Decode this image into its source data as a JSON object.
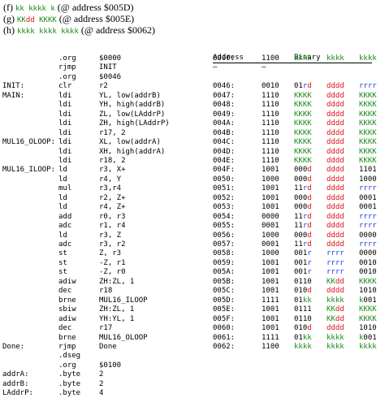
{
  "header_lines": [
    {
      "label": "(f)",
      "parts": [
        {
          "t": "kk",
          "c": "g"
        },
        {
          "t": " ",
          "c": "k"
        },
        {
          "t": "kkkk",
          "c": "g"
        },
        {
          "t": " ",
          "c": "k"
        },
        {
          "t": "k",
          "c": "g"
        }
      ],
      "suffix": "(@ address $005D)"
    },
    {
      "label": "(g)",
      "parts": [
        {
          "t": "KK",
          "c": "g"
        },
        {
          "t": "dd",
          "c": "r"
        },
        {
          "t": " ",
          "c": "k"
        },
        {
          "t": "KKKK",
          "c": "g"
        }
      ],
      "suffix": "(@ address $005E)"
    },
    {
      "label": "(h)",
      "parts": [
        {
          "t": "kkkk",
          "c": "g"
        },
        {
          "t": " ",
          "c": "k"
        },
        {
          "t": "kkkk",
          "c": "g"
        },
        {
          "t": " ",
          "c": "k"
        },
        {
          "t": "kkkk",
          "c": "g"
        }
      ],
      "suffix": "(@ address $0062)"
    }
  ],
  "table_headers": {
    "address": "Address",
    "binary": "Binary"
  },
  "colors": {
    "green": "#1a8a1a",
    "red": "#e0101a",
    "blue": "#1c3cdc"
  },
  "rows": [
    {
      "label": "",
      "op": ".org",
      "arg": "$0000",
      "addr": "0000:",
      "bin": [
        {
          "t": "1100",
          "c": "k"
        },
        {
          "t": "kkkk",
          "c": "g"
        },
        {
          "t": "kkkk",
          "c": "g"
        },
        {
          "t": "kkkk",
          "c": "g"
        }
      ]
    },
    {
      "label": "",
      "op": "rjmp",
      "arg": "INIT",
      "addr": "—",
      "bin": [
        {
          "t": "—",
          "c": "k"
        }
      ]
    },
    {
      "label": "",
      "op": ".org",
      "arg": "$0046",
      "addr": "",
      "bin": []
    },
    {
      "label": "INIT:",
      "op": "clr",
      "arg": "r2",
      "addr": "0046:",
      "bin": [
        {
          "t": "0010",
          "c": "k"
        },
        {
          "t": "01",
          "c": "k"
        },
        {
          "t": "r",
          "c": "b"
        },
        {
          "t": "d",
          "c": "r"
        },
        {
          "t": "dddd",
          "c": "r"
        },
        {
          "t": "rrrr",
          "c": "b"
        }
      ]
    },
    {
      "label": "MAIN:",
      "op": "ldi",
      "arg": "YL, low(addrB)",
      "addr": "0047:",
      "bin": [
        {
          "t": "1110",
          "c": "k"
        },
        {
          "t": "KKKK",
          "c": "g"
        },
        {
          "t": "dddd",
          "c": "r"
        },
        {
          "t": "KKKK",
          "c": "g"
        }
      ]
    },
    {
      "label": "",
      "op": "ldi",
      "arg": "YH, high(addrB)",
      "addr": "0048:",
      "bin": [
        {
          "t": "1110",
          "c": "k"
        },
        {
          "t": "KKKK",
          "c": "g"
        },
        {
          "t": "dddd",
          "c": "r"
        },
        {
          "t": "KKKK",
          "c": "g"
        }
      ]
    },
    {
      "label": "",
      "op": "ldi",
      "arg": "ZL, low(LAddrP)",
      "addr": "0049:",
      "bin": [
        {
          "t": "1110",
          "c": "k"
        },
        {
          "t": "KKKK",
          "c": "g"
        },
        {
          "t": "dddd",
          "c": "r"
        },
        {
          "t": "KKKK",
          "c": "g"
        }
      ]
    },
    {
      "label": "",
      "op": "ldi",
      "arg": "ZH, high(LAddrP)",
      "addr": "004A:",
      "bin": [
        {
          "t": "1110",
          "c": "k"
        },
        {
          "t": "KKKK",
          "c": "g"
        },
        {
          "t": "dddd",
          "c": "r"
        },
        {
          "t": "KKKK",
          "c": "g"
        }
      ]
    },
    {
      "label": "",
      "op": "ldi",
      "arg": "r17, 2",
      "addr": "004B:",
      "bin": [
        {
          "t": "1110",
          "c": "k"
        },
        {
          "t": "KKKK",
          "c": "g"
        },
        {
          "t": "dddd",
          "c": "r"
        },
        {
          "t": "KKKK",
          "c": "g"
        }
      ]
    },
    {
      "label": "MUL16_OLOOP:",
      "op": "ldi",
      "arg": "XL, low(addrA)",
      "addr": "004C:",
      "bin": [
        {
          "t": "1110",
          "c": "k"
        },
        {
          "t": "KKKK",
          "c": "g"
        },
        {
          "t": "dddd",
          "c": "r"
        },
        {
          "t": "KKKK",
          "c": "g"
        }
      ]
    },
    {
      "label": "",
      "op": "ldi",
      "arg": "XH, high(addrA)",
      "addr": "004D:",
      "bin": [
        {
          "t": "1110",
          "c": "k"
        },
        {
          "t": "KKKK",
          "c": "g"
        },
        {
          "t": "dddd",
          "c": "r"
        },
        {
          "t": "KKKK",
          "c": "g"
        }
      ]
    },
    {
      "label": "",
      "op": "ldi",
      "arg": "r18, 2",
      "addr": "004E:",
      "bin": [
        {
          "t": "1110",
          "c": "k"
        },
        {
          "t": "KKKK",
          "c": "g"
        },
        {
          "t": "dddd",
          "c": "r"
        },
        {
          "t": "KKKK",
          "c": "g"
        }
      ]
    },
    {
      "label": "MUL16_ILOOP:",
      "op": "ld",
      "arg": "r3, X+",
      "addr": "004F:",
      "bin": [
        {
          "t": "1001",
          "c": "k"
        },
        {
          "t": "000",
          "c": "k"
        },
        {
          "t": "d",
          "c": "r"
        },
        {
          "t": "dddd",
          "c": "r"
        },
        {
          "t": "1101",
          "c": "k"
        }
      ]
    },
    {
      "label": "",
      "op": "ld",
      "arg": "r4, Y",
      "addr": "0050:",
      "bin": [
        {
          "t": "1000",
          "c": "k"
        },
        {
          "t": "000",
          "c": "k"
        },
        {
          "t": "d",
          "c": "r"
        },
        {
          "t": "dddd",
          "c": "r"
        },
        {
          "t": "1000",
          "c": "k"
        }
      ]
    },
    {
      "label": "",
      "op": "mul",
      "arg": "r3,r4",
      "addr": "0051:",
      "bin": [
        {
          "t": "1001",
          "c": "k"
        },
        {
          "t": "11",
          "c": "k"
        },
        {
          "t": "r",
          "c": "b"
        },
        {
          "t": "d",
          "c": "r"
        },
        {
          "t": "dddd",
          "c": "r"
        },
        {
          "t": "rrrr",
          "c": "b"
        }
      ]
    },
    {
      "label": "",
      "op": "ld",
      "arg": "r2, Z+",
      "addr": "0052:",
      "bin": [
        {
          "t": "1001",
          "c": "k"
        },
        {
          "t": "000",
          "c": "k"
        },
        {
          "t": "d",
          "c": "r"
        },
        {
          "t": "dddd",
          "c": "r"
        },
        {
          "t": "0001",
          "c": "k"
        }
      ]
    },
    {
      "label": "",
      "op": "ld",
      "arg": "r4, Z+",
      "addr": "0053:",
      "bin": [
        {
          "t": "1001",
          "c": "k"
        },
        {
          "t": "000",
          "c": "k"
        },
        {
          "t": "d",
          "c": "r"
        },
        {
          "t": "dddd",
          "c": "r"
        },
        {
          "t": "0001",
          "c": "k"
        }
      ]
    },
    {
      "label": "",
      "op": "add",
      "arg": "r0, r3",
      "addr": "0054:",
      "bin": [
        {
          "t": "0000",
          "c": "k"
        },
        {
          "t": "11",
          "c": "k"
        },
        {
          "t": "r",
          "c": "b"
        },
        {
          "t": "d",
          "c": "r"
        },
        {
          "t": "dddd",
          "c": "r"
        },
        {
          "t": "rrrr",
          "c": "b"
        }
      ]
    },
    {
      "label": "",
      "op": "adc",
      "arg": "r1, r4",
      "addr": "0055:",
      "bin": [
        {
          "t": "0001",
          "c": "k"
        },
        {
          "t": "11",
          "c": "k"
        },
        {
          "t": "r",
          "c": "b"
        },
        {
          "t": "d",
          "c": "r"
        },
        {
          "t": "dddd",
          "c": "r"
        },
        {
          "t": "rrrr",
          "c": "b"
        }
      ]
    },
    {
      "label": "",
      "op": "ld",
      "arg": "r3, Z",
      "addr": "0056:",
      "bin": [
        {
          "t": "1000",
          "c": "k"
        },
        {
          "t": "000",
          "c": "k"
        },
        {
          "t": "d",
          "c": "r"
        },
        {
          "t": "dddd",
          "c": "r"
        },
        {
          "t": "0000",
          "c": "k"
        }
      ]
    },
    {
      "label": "",
      "op": "adc",
      "arg": "r3, r2",
      "addr": "0057:",
      "bin": [
        {
          "t": "0001",
          "c": "k"
        },
        {
          "t": "11",
          "c": "k"
        },
        {
          "t": "r",
          "c": "b"
        },
        {
          "t": "d",
          "c": "r"
        },
        {
          "t": "dddd",
          "c": "r"
        },
        {
          "t": "rrrr",
          "c": "b"
        }
      ]
    },
    {
      "label": "",
      "op": "st",
      "arg": "Z, r3",
      "addr": "0058:",
      "bin": [
        {
          "t": "1000",
          "c": "k"
        },
        {
          "t": "001",
          "c": "k"
        },
        {
          "t": "r",
          "c": "b"
        },
        {
          "t": "rrrr",
          "c": "b"
        },
        {
          "t": "0000",
          "c": "k"
        }
      ]
    },
    {
      "label": "",
      "op": "st",
      "arg": "-Z, r1",
      "addr": "0059:",
      "bin": [
        {
          "t": "1001",
          "c": "k"
        },
        {
          "t": "001",
          "c": "k"
        },
        {
          "t": "r",
          "c": "b"
        },
        {
          "t": "rrrr",
          "c": "b"
        },
        {
          "t": "0010",
          "c": "k"
        }
      ]
    },
    {
      "label": "",
      "op": "st",
      "arg": "-Z, r0",
      "addr": "005A:",
      "bin": [
        {
          "t": "1001",
          "c": "k"
        },
        {
          "t": "001",
          "c": "k"
        },
        {
          "t": "r",
          "c": "b"
        },
        {
          "t": "rrrr",
          "c": "b"
        },
        {
          "t": "0010",
          "c": "k"
        }
      ]
    },
    {
      "label": "",
      "op": "adiw",
      "arg": "ZH:ZL, 1",
      "addr": "005B:",
      "bin": [
        {
          "t": "1001",
          "c": "k"
        },
        {
          "t": "0110",
          "c": "k"
        },
        {
          "t": "KK",
          "c": "g"
        },
        {
          "t": "dd",
          "c": "r"
        },
        {
          "t": "KKKK",
          "c": "g"
        }
      ]
    },
    {
      "label": "",
      "op": "dec",
      "arg": "r18",
      "addr": "005C:",
      "bin": [
        {
          "t": "1001",
          "c": "k"
        },
        {
          "t": "010",
          "c": "k"
        },
        {
          "t": "d",
          "c": "r"
        },
        {
          "t": "dddd",
          "c": "r"
        },
        {
          "t": "1010",
          "c": "k"
        }
      ]
    },
    {
      "label": "",
      "op": "brne",
      "arg": "MUL16_ILOOP",
      "addr": "005D:",
      "bin": [
        {
          "t": "1111",
          "c": "k"
        },
        {
          "t": "01",
          "c": "k"
        },
        {
          "t": "kk",
          "c": "g"
        },
        {
          "t": "kkkk",
          "c": "g"
        },
        {
          "t": "k",
          "c": "g"
        },
        {
          "t": "001",
          "c": "k"
        }
      ]
    },
    {
      "label": "",
      "op": "sbiw",
      "arg": "ZH:ZL, 1",
      "addr": "005E:",
      "bin": [
        {
          "t": "1001",
          "c": "k"
        },
        {
          "t": "0111",
          "c": "k"
        },
        {
          "t": "KK",
          "c": "g"
        },
        {
          "t": "dd",
          "c": "r"
        },
        {
          "t": "KKKK",
          "c": "g"
        }
      ]
    },
    {
      "label": "",
      "op": "adiw",
      "arg": "YH:YL, 1",
      "addr": "005F:",
      "bin": [
        {
          "t": "1001",
          "c": "k"
        },
        {
          "t": "0110",
          "c": "k"
        },
        {
          "t": "KK",
          "c": "g"
        },
        {
          "t": "dd",
          "c": "r"
        },
        {
          "t": "KKKK",
          "c": "g"
        }
      ]
    },
    {
      "label": "",
      "op": "dec",
      "arg": "r17",
      "addr": "0060:",
      "bin": [
        {
          "t": "1001",
          "c": "k"
        },
        {
          "t": "010",
          "c": "k"
        },
        {
          "t": "d",
          "c": "r"
        },
        {
          "t": "dddd",
          "c": "r"
        },
        {
          "t": "1010",
          "c": "k"
        }
      ]
    },
    {
      "label": "",
      "op": "brne",
      "arg": "MUL16_OLOOP",
      "addr": "0061:",
      "bin": [
        {
          "t": "1111",
          "c": "k"
        },
        {
          "t": "01",
          "c": "k"
        },
        {
          "t": "kk",
          "c": "g"
        },
        {
          "t": "kkkk",
          "c": "g"
        },
        {
          "t": "k",
          "c": "g"
        },
        {
          "t": "001",
          "c": "k"
        }
      ]
    },
    {
      "label": "Done:",
      "op": "rjmp",
      "arg": "Done",
      "addr": "0062:",
      "bin": [
        {
          "t": "1100",
          "c": "k"
        },
        {
          "t": "kkkk",
          "c": "g"
        },
        {
          "t": "kkkk",
          "c": "g"
        },
        {
          "t": "kkkk",
          "c": "g"
        }
      ]
    },
    {
      "label": "",
      "op": ".dseg",
      "arg": "",
      "addr": "",
      "bin": []
    },
    {
      "label": "",
      "op": ".org",
      "arg": "$0100",
      "addr": "",
      "bin": []
    },
    {
      "label": "addrA:",
      "op": ".byte",
      "arg": "2",
      "addr": "",
      "bin": []
    },
    {
      "label": "addrB:",
      "op": ".byte",
      "arg": "2",
      "addr": "",
      "bin": []
    },
    {
      "label": "LAddrP:",
      "op": ".byte",
      "arg": "4",
      "addr": "",
      "bin": []
    }
  ]
}
